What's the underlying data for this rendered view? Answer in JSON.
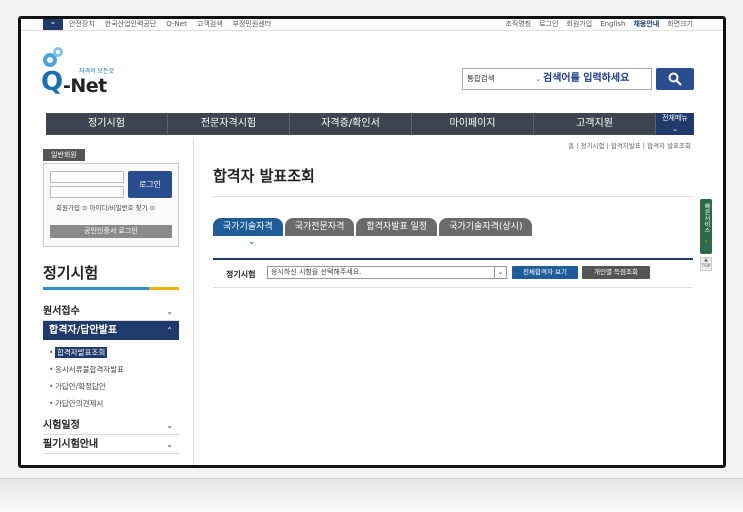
{
  "utility": {
    "left_links": [
      "안전장치",
      "한국산업인력공단",
      "Q-Net",
      "고객검색",
      "부정민원센터"
    ],
    "right_links": [
      "조직명칭",
      "로그인",
      "회원가입",
      "English",
      "사이트맵"
    ],
    "highlight_link": "채용안내",
    "extra": "화면크기"
  },
  "logo": {
    "tagline": "자격의 모든것",
    "q": "Q",
    "net": "-Net"
  },
  "search": {
    "scope": "통합검색",
    "placeholder": "검색어를 입력하세요",
    "scope_icon": "chevron-down-icon",
    "button_icon": "search-icon"
  },
  "gnb": {
    "items": [
      "정기시험",
      "전문자격시험",
      "자격증/확인서",
      "마이페이지",
      "고객지원"
    ],
    "all_menu": "전체메뉴"
  },
  "breadcrumb": "홈 | 정기시험 | 합격자발표 | 합격자 발표조회",
  "member": {
    "tab": "일반회원",
    "login_button": "로그인",
    "links": "회원가입 ⊙  아이디/비밀번호 찾기 ⊙",
    "cert_button": "공인인증서 로그인"
  },
  "sidebar": {
    "title": "정기시험",
    "items": [
      {
        "label": "원서접수",
        "icon": "chevron-down-icon"
      },
      {
        "label": "합격자/답안발표",
        "icon": "chevron-up-icon",
        "active": true
      },
      {
        "label": "시험일정",
        "icon": "chevron-down-icon"
      },
      {
        "label": "필기시험안내",
        "icon": "chevron-down-icon"
      }
    ],
    "sub_items": [
      "합격자발표조회",
      "응시서류불합격자발표",
      "가답안/확정답안",
      "가답안의견제시"
    ]
  },
  "main": {
    "title": "합격자 발표조회",
    "tabs": [
      "국가기술자격",
      "국가전문자격",
      "합격자발표 일정",
      "국가기술자격(상시)"
    ],
    "filter_label": "정기시험",
    "select_value": "응시하신 시험을 선택해주세요.",
    "btn_all": "전체합격자 보기",
    "btn_personal": "개인별 득점조회"
  },
  "quick": {
    "label": "빠른서비스",
    "top": "TOP"
  },
  "colors": {
    "navy": "#1f3a6b",
    "tab_blue": "#1f5d9a",
    "gnb_gray": "#3d4552"
  }
}
